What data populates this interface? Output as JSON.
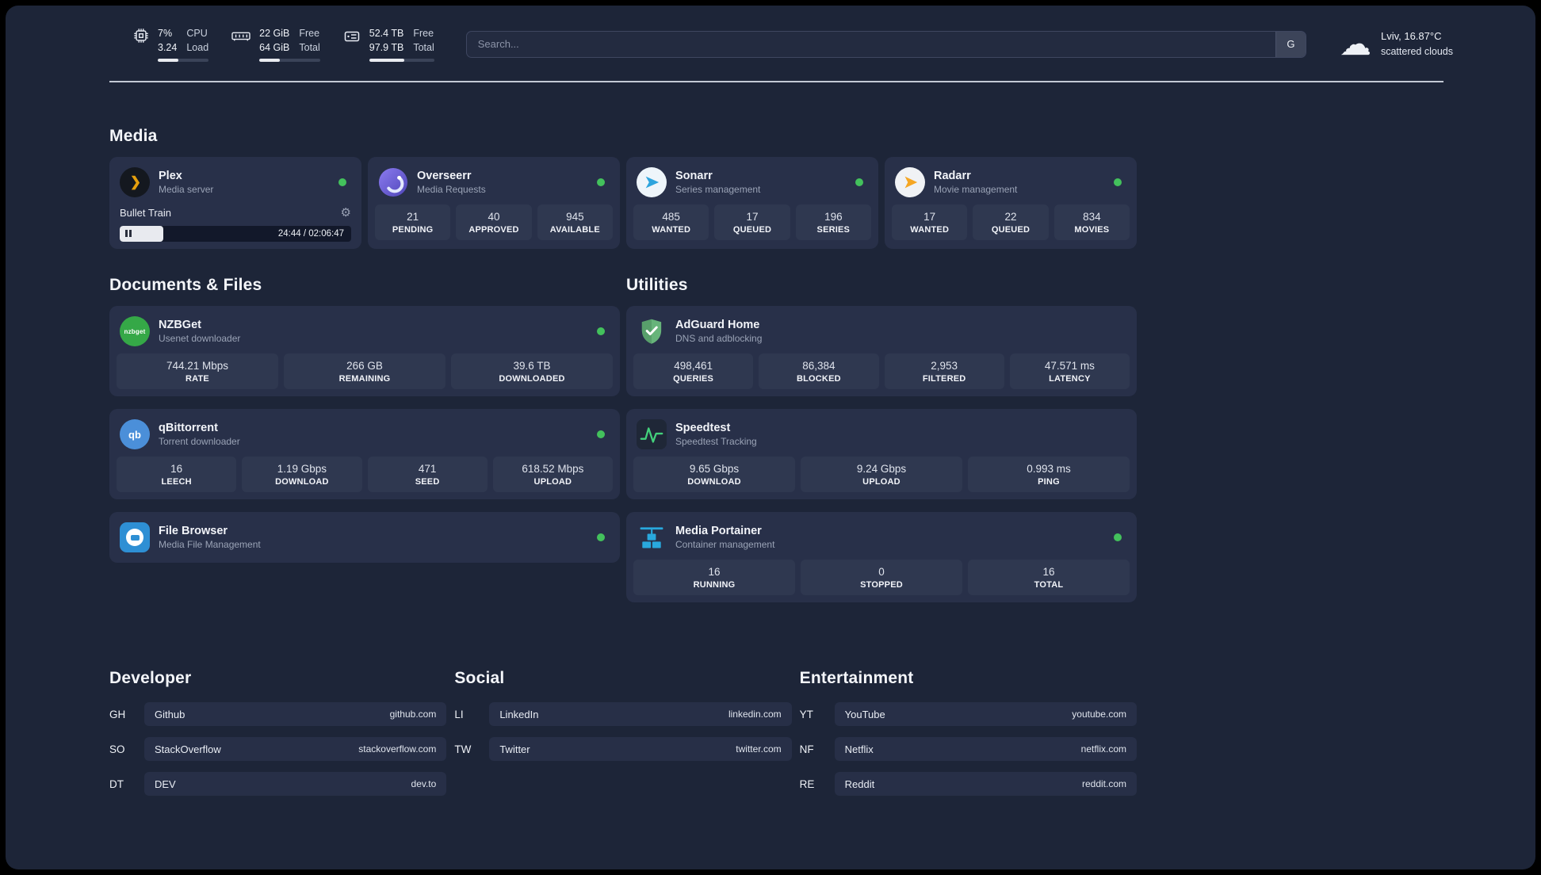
{
  "topbar": {
    "cpu": {
      "value1": "7%",
      "value2": "3.24",
      "label1": "CPU",
      "label2": "Load"
    },
    "ram": {
      "value1": "22 GiB",
      "value2": "64 GiB",
      "label1": "Free",
      "label2": "Total"
    },
    "disk": {
      "value1": "52.4 TB",
      "value2": "97.9 TB",
      "label1": "Free",
      "label2": "Total"
    },
    "search": {
      "placeholder": "Search...",
      "engine_button": "G"
    },
    "weather": {
      "location": "Lviv, 16.87°C",
      "condition": "scattered clouds"
    }
  },
  "sections": {
    "media": {
      "heading": "Media",
      "cards": [
        {
          "name": "Plex",
          "subtitle": "Media server",
          "player": {
            "title": "Bullet Train",
            "time": "24:44 / 02:06:47"
          }
        },
        {
          "name": "Overseerr",
          "subtitle": "Media Requests",
          "stats": [
            {
              "value": "21",
              "label": "PENDING"
            },
            {
              "value": "40",
              "label": "APPROVED"
            },
            {
              "value": "945",
              "label": "AVAILABLE"
            }
          ]
        },
        {
          "name": "Sonarr",
          "subtitle": "Series management",
          "stats": [
            {
              "value": "485",
              "label": "WANTED"
            },
            {
              "value": "17",
              "label": "QUEUED"
            },
            {
              "value": "196",
              "label": "SERIES"
            }
          ]
        },
        {
          "name": "Radarr",
          "subtitle": "Movie management",
          "stats": [
            {
              "value": "17",
              "label": "WANTED"
            },
            {
              "value": "22",
              "label": "QUEUED"
            },
            {
              "value": "834",
              "label": "MOVIES"
            }
          ]
        }
      ]
    },
    "documents": {
      "heading": "Documents & Files",
      "cards": [
        {
          "name": "NZBGet",
          "subtitle": "Usenet downloader",
          "icon_text": "nzbget",
          "stats": [
            {
              "value": "744.21 Mbps",
              "label": "RATE"
            },
            {
              "value": "266 GB",
              "label": "REMAINING"
            },
            {
              "value": "39.6 TB",
              "label": "DOWNLOADED"
            }
          ]
        },
        {
          "name": "qBittorrent",
          "subtitle": "Torrent downloader",
          "icon_text": "qb",
          "stats": [
            {
              "value": "16",
              "label": "LEECH"
            },
            {
              "value": "1.19 Gbps",
              "label": "DOWNLOAD"
            },
            {
              "value": "471",
              "label": "SEED"
            },
            {
              "value": "618.52 Mbps",
              "label": "UPLOAD"
            }
          ]
        },
        {
          "name": "File Browser",
          "subtitle": "Media File Management",
          "stats": []
        }
      ]
    },
    "utilities": {
      "heading": "Utilities",
      "cards": [
        {
          "name": "AdGuard Home",
          "subtitle": "DNS and adblocking",
          "stats": [
            {
              "value": "498,461",
              "label": "QUERIES"
            },
            {
              "value": "86,384",
              "label": "BLOCKED"
            },
            {
              "value": "2,953",
              "label": "FILTERED"
            },
            {
              "value": "47.571 ms",
              "label": "LATENCY"
            }
          ]
        },
        {
          "name": "Speedtest",
          "subtitle": "Speedtest Tracking",
          "stats": [
            {
              "value": "9.65 Gbps",
              "label": "DOWNLOAD"
            },
            {
              "value": "9.24 Gbps",
              "label": "UPLOAD"
            },
            {
              "value": "0.993 ms",
              "label": "PING"
            }
          ]
        },
        {
          "name": "Media Portainer",
          "subtitle": "Container management",
          "stats": [
            {
              "value": "16",
              "label": "RUNNING"
            },
            {
              "value": "0",
              "label": "STOPPED"
            },
            {
              "value": "16",
              "label": "TOTAL"
            }
          ]
        }
      ]
    }
  },
  "bookmarks": [
    {
      "heading": "Developer",
      "items": [
        {
          "abbr": "GH",
          "name": "Github",
          "url": "github.com"
        },
        {
          "abbr": "SO",
          "name": "StackOverflow",
          "url": "stackoverflow.com"
        },
        {
          "abbr": "DT",
          "name": "DEV",
          "url": "dev.to"
        }
      ]
    },
    {
      "heading": "Social",
      "items": [
        {
          "abbr": "LI",
          "name": "LinkedIn",
          "url": "linkedin.com"
        },
        {
          "abbr": "TW",
          "name": "Twitter",
          "url": "twitter.com"
        }
      ]
    },
    {
      "heading": "Entertainment",
      "items": [
        {
          "abbr": "YT",
          "name": "YouTube",
          "url": "youtube.com"
        },
        {
          "abbr": "NF",
          "name": "Netflix",
          "url": "netflix.com"
        },
        {
          "abbr": "RE",
          "name": "Reddit",
          "url": "reddit.com"
        }
      ]
    }
  ],
  "colors": {
    "accent_green": "#43c15c"
  }
}
